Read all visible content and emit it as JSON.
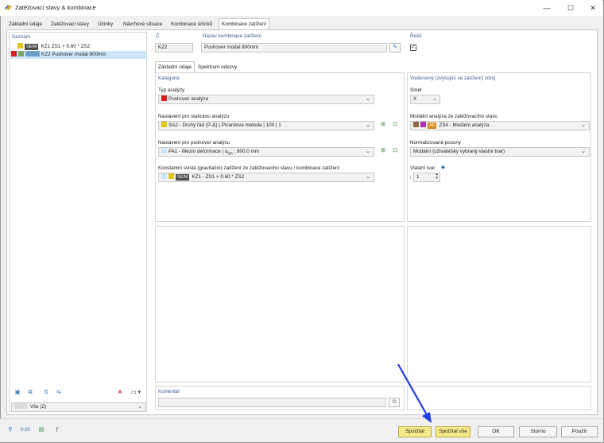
{
  "window": {
    "title": "Zatěžovací stavy & kombinace",
    "minimize": "—",
    "maximize": "☐",
    "close": "✕"
  },
  "tabs": [
    {
      "label": "Základní údaje"
    },
    {
      "label": "Zatěžovací stavy"
    },
    {
      "label": "Účinky"
    },
    {
      "label": "Návrhové situace"
    },
    {
      "label": "Kombinace účinků"
    },
    {
      "label": "Kombinace zatížení"
    }
  ],
  "sidebar": {
    "title": "Seznam",
    "items": [
      {
        "tag": "SE/M",
        "id": "KZ1",
        "name": "ZS1 + 0.60 * ZS2"
      },
      {
        "tag": "",
        "id": "KZ2",
        "name": "Pushover modal 800mm"
      }
    ],
    "filter_value": "Vše (2)"
  },
  "header": {
    "no_label": "Č.",
    "no_value": "KZ2",
    "name_label": "Název kombinace zatížení",
    "name_value": "Pushover modal 800mm",
    "solve_label": "Řešit",
    "solve_checked": "✓"
  },
  "subtabs": [
    {
      "label": "Základní údaje"
    },
    {
      "label": "Spektrum odezvy"
    }
  ],
  "category": {
    "title": "Kategorie",
    "analysis_type_label": "Typ analýzy",
    "analysis_type_value": "Pushover analýza",
    "static_label": "Nastavení pro statickou analýzu",
    "static_value": "SA2 - Druhý řád (P-Δ) | Picardova metoda | 100 | 1",
    "pushover_label": "Nastavení pro pushover analýzu",
    "pushover_value": "PA1 - Mezní deformace | u<sub>lim</sub> : 800.0 mm",
    "pushover_value_text": "PA1 - Mezní deformace | u",
    "pushover_sub": "lim",
    "pushover_tail": " : 800.0 mm",
    "gravity_label": "Konstantní svislá (gravitační) zatížení ze zatěžovacího stavu / kombinace zatížení",
    "gravity_tag": "SE/M",
    "gravity_value": "KZ1 - ZS1 + 0.60 * ZS2"
  },
  "source": {
    "title": "Vodorovný (zvyšující se zatížení) zdroj",
    "direction_label": "Směr",
    "direction_value": "X",
    "modal_label": "Modální analýza ze zatěžovacího stavu",
    "modal_tag": "AE",
    "modal_value": "ZS4 - Modální analýza",
    "norm_label": "Normalizované posuny",
    "norm_value": "Modální (uživatelsky vybraný vlastní tvar)",
    "mode_label": "Vlastní tvar",
    "mode_prefix": "i",
    "mode_value": "1"
  },
  "comment_label": "Komentář",
  "footer_buttons": {
    "calculate": "Spočítat",
    "calculate_all": "Spočítat vše",
    "ok": "OK",
    "cancel": "Storno",
    "apply": "Použít"
  },
  "colors": {
    "accent_yellow": "#f5e98a",
    "selection": "#cde6f7",
    "section_title": "#3c5d8f",
    "arrow": "#1f3fe0"
  }
}
